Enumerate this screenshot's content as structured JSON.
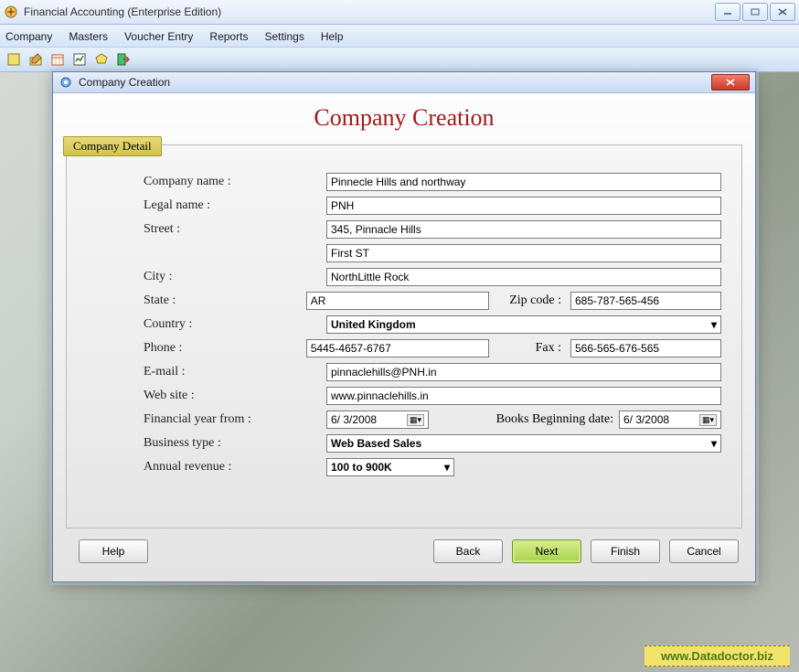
{
  "window": {
    "title": "Financial Accounting (Enterprise Edition)"
  },
  "menu": {
    "company": "Company",
    "masters": "Masters",
    "voucher": "Voucher Entry",
    "reports": "Reports",
    "settings": "Settings",
    "help": "Help"
  },
  "dialog": {
    "title": "Company Creation",
    "heading": "Company Creation",
    "group_label": "Company Detail"
  },
  "labels": {
    "company_name": "Company name :",
    "legal_name": "Legal name :",
    "street": "Street :",
    "city": "City :",
    "state": "State :",
    "zip": "Zip code :",
    "country": "Country :",
    "phone": "Phone :",
    "fax": "Fax :",
    "email": "E-mail :",
    "website": "Web site :",
    "fin_year_from": "Financial year from :",
    "books_begin": "Books Beginning date:",
    "business_type": "Business type :",
    "annual_revenue": "Annual revenue :"
  },
  "values": {
    "company_name": "Pinnecle Hills and northway",
    "legal_name": "PNH",
    "street1": "345, Pinnacle Hills",
    "street2": "First ST",
    "city": "NorthLittle Rock",
    "state": "AR",
    "zip": "685-787-565-456",
    "country": "United Kingdom",
    "phone": "5445-4657-6767",
    "fax": "566-565-676-565",
    "email": "pinnaclehills@PNH.in",
    "website": "www.pinnaclehills.in",
    "fin_year_from": "6/ 3/2008",
    "books_begin": "6/ 3/2008",
    "business_type": "Web Based Sales",
    "annual_revenue": "100 to 900K"
  },
  "buttons": {
    "help": "Help",
    "back": "Back",
    "next": "Next",
    "finish": "Finish",
    "cancel": "Cancel"
  },
  "watermark": "www.Datadoctor.biz"
}
